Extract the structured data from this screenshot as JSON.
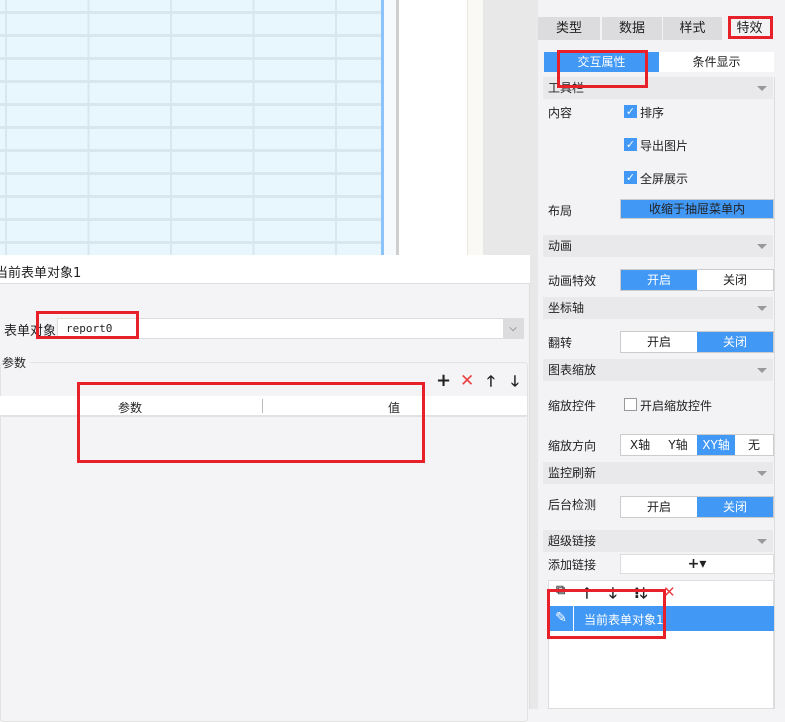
{
  "bottom_panel": {
    "title": "当前表单对象1",
    "form_object_label": "表单对象",
    "form_object_value": "report0",
    "params_group_label": "参数",
    "table_headers": [
      "参数",
      "值"
    ],
    "toolbar_icons": [
      "plus-icon",
      "delete-icon",
      "arrow-up-icon",
      "arrow-down-icon"
    ]
  },
  "right_panel": {
    "tabs": [
      "类型",
      "数据",
      "样式",
      "特效"
    ],
    "active_tab": "特效",
    "subtabs": [
      "交互属性",
      "条件显示"
    ],
    "active_subtab": "交互属性",
    "toolbar": {
      "title": "工具栏",
      "content_label": "内容",
      "options": [
        {
          "label": "排序",
          "checked": true
        },
        {
          "label": "导出图片",
          "checked": true
        },
        {
          "label": "全屏展示",
          "checked": true
        }
      ],
      "layout_label": "布局",
      "layout_value": "收缩于抽屉菜单内"
    },
    "animation": {
      "title": "动画",
      "label": "动画特效",
      "options": [
        "开启",
        "关闭"
      ],
      "selected": "开启"
    },
    "axis": {
      "title": "坐标轴",
      "label": "翻转",
      "options": [
        "开启",
        "关闭"
      ],
      "selected": "关闭"
    },
    "zoom": {
      "title": "图表缩放",
      "control_label": "缩放控件",
      "control_checkbox": "开启缩放控件",
      "control_checked": false,
      "direction_label": "缩放方向",
      "direction_options": [
        "X轴",
        "Y轴",
        "XY轴",
        "无"
      ],
      "direction_selected": "XY轴"
    },
    "monitor": {
      "title": "监控刷新",
      "label": "后台检测",
      "options": [
        "开启",
        "关闭"
      ],
      "selected": "关闭"
    },
    "hyperlink": {
      "title": "超级链接",
      "add_label": "添加链接",
      "add_button": "+▾",
      "items": [
        "当前表单对象1"
      ]
    }
  },
  "colors": {
    "accent": "#4198f5",
    "highlight": "#e8202a"
  }
}
